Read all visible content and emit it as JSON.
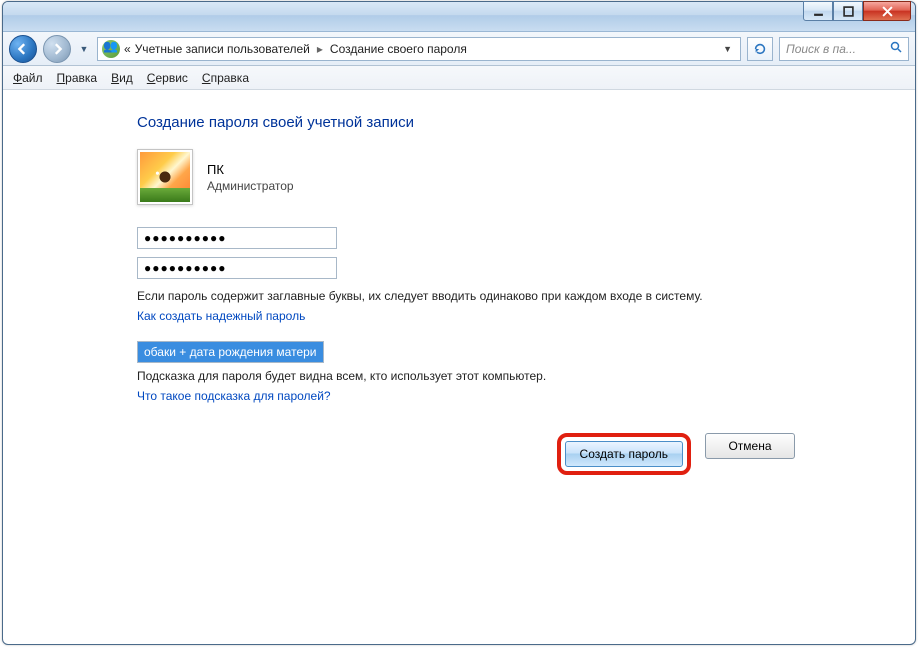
{
  "titlebar": {
    "min_icon": "minimize-icon",
    "max_icon": "maximize-icon",
    "close_icon": "close-icon"
  },
  "nav": {
    "breadcrumb_prefix": "«",
    "breadcrumb_1": "Учетные записи пользователей",
    "breadcrumb_2": "Создание своего пароля",
    "search_placeholder": "Поиск в па..."
  },
  "menu": {
    "file_u": "Ф",
    "file_rest": "айл",
    "edit_u": "П",
    "edit_rest": "равка",
    "view_u": "В",
    "view_rest": "ид",
    "service_u": "С",
    "service_rest": "ервис",
    "help_u": "С",
    "help_rest": "правка"
  },
  "page": {
    "title": "Создание пароля своей учетной записи",
    "user_name": "ПК",
    "user_role": "Администратор",
    "pw1_mask": "●●●●●●●●●●",
    "pw2_mask": "●●●●●●●●●●",
    "caps_note": "Если пароль содержит заглавные буквы, их следует вводить одинаково при каждом входе в систему.",
    "link_strong_pw": "Как создать надежный пароль",
    "hint_value": "обаки + дата рождения матери",
    "hint_note": "Подсказка для пароля будет видна всем, кто использует этот компьютер.",
    "link_hint_help": "Что такое подсказка для паролей?",
    "btn_create": "Создать пароль",
    "btn_cancel": "Отмена"
  }
}
